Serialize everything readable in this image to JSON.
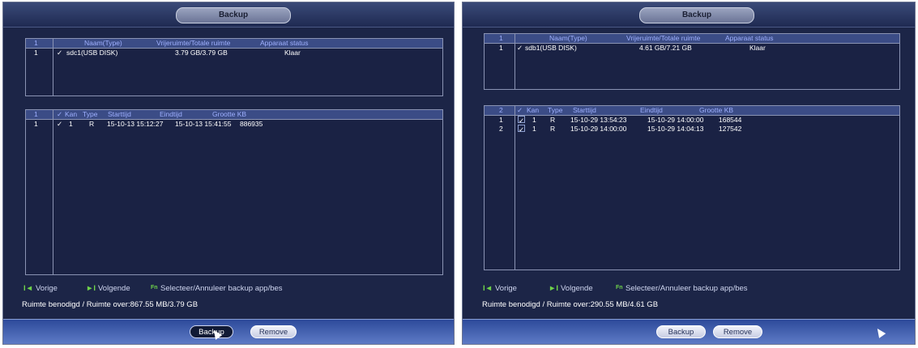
{
  "left": {
    "title": "Backup",
    "device_list": {
      "headers": [
        "1",
        "Naam(Type)",
        "Vrijeruimte/Totale ruimte",
        "Apparaat status"
      ],
      "rows": [
        {
          "idx": "1",
          "check": "✓",
          "name": "sdc1(USB DISK)",
          "space": "3.79 GB/3.79 GB",
          "status": "Klaar"
        }
      ]
    },
    "file_list": {
      "headers": [
        "1",
        "✓",
        "Kan",
        "Type",
        "Starttijd",
        "Eindtijd",
        "Grootte KB"
      ],
      "rows": [
        {
          "idx": "1",
          "check": "✓",
          "ch": "1",
          "type": "R",
          "start": "15-10-13 15:12:27",
          "end": "15-10-13 15:41:55",
          "size": "886935"
        }
      ]
    },
    "legend": {
      "prev_key": "I◄",
      "prev": "Vorige",
      "next_key": "►I",
      "next": "Volgende",
      "select_key": "Fn",
      "select": "Selecteer/Annuleer backup app/bes"
    },
    "space_text": "Ruimte benodigd / Ruimte over:867.55 MB/3.79 GB",
    "buttons": {
      "backup": "Backup",
      "remove": "Remove"
    }
  },
  "right": {
    "title": "Backup",
    "device_list": {
      "headers": [
        "1",
        "Naam(Type)",
        "Vrijeruimte/Totale ruimte",
        "Apparaat status"
      ],
      "rows": [
        {
          "idx": "1",
          "check": "✓",
          "name": "sdb1(USB DISK)",
          "space": "4.61 GB/7.21 GB",
          "status": "Klaar"
        }
      ]
    },
    "file_list": {
      "headers": [
        "2",
        "✓",
        "Kan",
        "Type",
        "Starttijd",
        "Eindtijd",
        "Grootte KB"
      ],
      "rows": [
        {
          "idx": "1",
          "check": "✓",
          "ch": "1",
          "type": "R",
          "start": "15-10-29 13:54:23",
          "end": "15-10-29 14:00:00",
          "size": "168544"
        },
        {
          "idx": "2",
          "check": "✓",
          "ch": "1",
          "type": "R",
          "start": "15-10-29 14:00:00",
          "end": "15-10-29 14:04:13",
          "size": "127542"
        }
      ]
    },
    "legend": {
      "prev_key": "I◄",
      "prev": "Vorige",
      "next_key": "►I",
      "next": "Volgende",
      "select_key": "Fn",
      "select": "Selecteer/Annuleer backup app/bes"
    },
    "space_text": "Ruimte benodigd / Ruimte over:290.55 MB/4.61 GB",
    "buttons": {
      "backup": "Backup",
      "remove": "Remove"
    }
  },
  "colors": {
    "panel_bg": "#1c2547",
    "list_header_bg": "#3b4c86",
    "bottom_bar": "#4a67b8",
    "legend_key": "#6fd34a"
  }
}
